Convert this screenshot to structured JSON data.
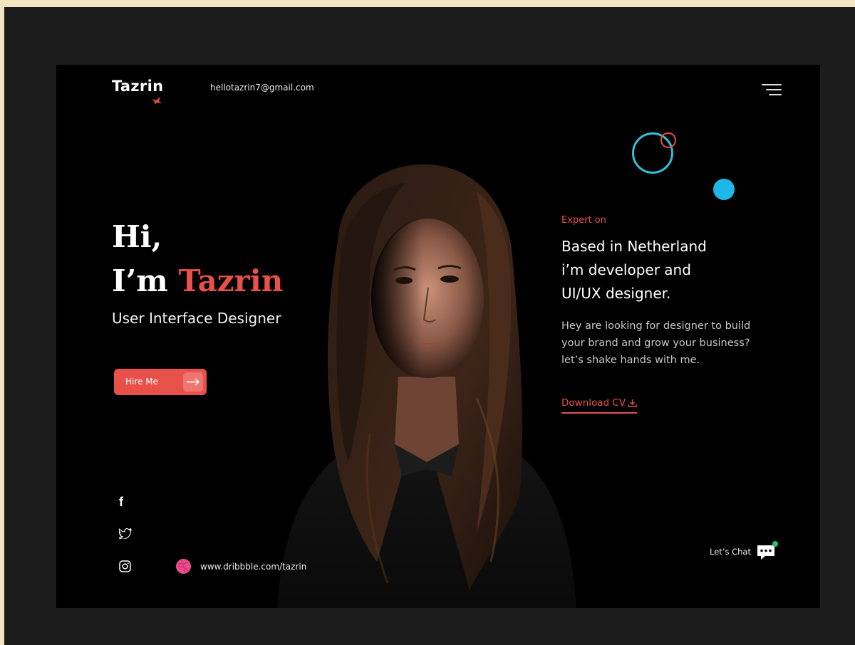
{
  "header": {
    "logo": "Tazrin",
    "email": "hellotazrin7@gmail.com"
  },
  "hero": {
    "greeting": "Hi,",
    "intro_prefix": "I’m",
    "name": "Tazrin",
    "role": "User Interface Designer",
    "hire_button_label": "Hire Me"
  },
  "about": {
    "eyebrow": "Expert on",
    "headline_lines": [
      "Based in Netherland",
      "i’m developer and",
      "UI/UX designer."
    ],
    "description_lines": [
      "Hey are looking for designer to build",
      "your brand and grow your business?",
      "let’s shake hands with me."
    ],
    "download_label": "Download CV"
  },
  "footer": {
    "social_icons": [
      "facebook-icon",
      "twitter-icon",
      "instagram-icon"
    ],
    "dribbble_url": "www.dribbble.com/tazrin",
    "chat_label": "Let’s Chat"
  },
  "colors": {
    "accent": "#e8504a",
    "cyan": "#2ec3d6",
    "blue_dot": "#1fb6e8",
    "dribbble": "#ea4c89",
    "online": "#22c55e"
  }
}
